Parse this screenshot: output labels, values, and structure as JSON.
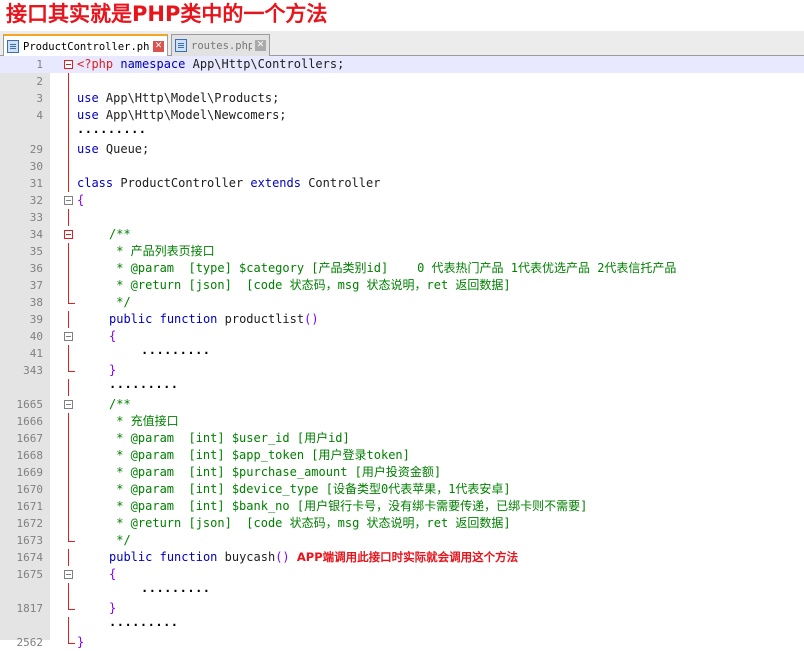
{
  "heading": "接口其实就是PHP类中的一个方法",
  "tabs": [
    {
      "label": "ProductController.php",
      "close": "✕"
    },
    {
      "label": "routes.php",
      "close": "✕"
    }
  ],
  "lines": [
    {
      "num": "1",
      "fold": "box-red",
      "cur": true,
      "indent": 0,
      "segments": [
        {
          "c": "php",
          "t": "<?php"
        },
        {
          "c": "pl",
          "t": " "
        },
        {
          "c": "kw",
          "t": "namespace"
        },
        {
          "c": "pl",
          "t": " App\\Http\\Controllers;"
        }
      ]
    },
    {
      "num": "2",
      "fold": "line",
      "indent": 0,
      "segments": []
    },
    {
      "num": "3",
      "fold": "line",
      "indent": 0,
      "segments": [
        {
          "c": "kw",
          "t": "use"
        },
        {
          "c": "pl",
          "t": " App\\Http\\Model\\Products;"
        }
      ]
    },
    {
      "num": "4",
      "fold": "line",
      "indent": 0,
      "segments": [
        {
          "c": "kw",
          "t": "use"
        },
        {
          "c": "pl",
          "t": " App\\Http\\Model\\Newcomers;"
        }
      ]
    },
    {
      "num": "",
      "fold": "line",
      "indent": 0,
      "segments": [
        {
          "c": "dots",
          "t": "·········"
        }
      ]
    },
    {
      "num": "29",
      "fold": "line",
      "indent": 0,
      "segments": [
        {
          "c": "kw",
          "t": "use"
        },
        {
          "c": "pl",
          "t": " Queue;"
        }
      ]
    },
    {
      "num": "30",
      "fold": "line",
      "indent": 0,
      "segments": []
    },
    {
      "num": "31",
      "fold": "line",
      "indent": 0,
      "segments": [
        {
          "c": "kw",
          "t": "class"
        },
        {
          "c": "pl",
          "t": " ProductController "
        },
        {
          "c": "kw",
          "t": "extends"
        },
        {
          "c": "pl",
          "t": " Controller"
        }
      ]
    },
    {
      "num": "32",
      "fold": "box-grey",
      "indent": 0,
      "segments": [
        {
          "c": "br",
          "t": "{"
        }
      ]
    },
    {
      "num": "33",
      "fold": "line",
      "indent": 1,
      "segments": []
    },
    {
      "num": "34",
      "fold": "box-red",
      "indent": 1,
      "segments": [
        {
          "c": "cm",
          "t": "/**"
        }
      ]
    },
    {
      "num": "35",
      "fold": "line",
      "indent": 1,
      "segments": [
        {
          "c": "cm",
          "t": " * 产品列表页接口"
        }
      ]
    },
    {
      "num": "36",
      "fold": "line",
      "indent": 1,
      "segments": [
        {
          "c": "cm",
          "t": " * @param  [type] $category [产品类别id]    0 代表热门产品 1代表优选产品 2代表信托产品"
        }
      ]
    },
    {
      "num": "37",
      "fold": "line",
      "indent": 1,
      "segments": [
        {
          "c": "cm",
          "t": " * @return [json]  [code 状态码，msg 状态说明，ret 返回数据]"
        }
      ]
    },
    {
      "num": "38",
      "fold": "end",
      "indent": 1,
      "segments": [
        {
          "c": "cm",
          "t": " */"
        }
      ]
    },
    {
      "num": "39",
      "fold": "line",
      "indent": 1,
      "segments": [
        {
          "c": "kw",
          "t": "public"
        },
        {
          "c": "pl",
          "t": " "
        },
        {
          "c": "kw",
          "t": "function"
        },
        {
          "c": "pl",
          "t": " productlist"
        },
        {
          "c": "br",
          "t": "()"
        }
      ]
    },
    {
      "num": "40",
      "fold": "box-grey",
      "indent": 1,
      "segments": [
        {
          "c": "br",
          "t": "{"
        }
      ]
    },
    {
      "num": "41",
      "fold": "line",
      "indent": 2,
      "segments": [
        {
          "c": "dots",
          "t": "·········"
        }
      ]
    },
    {
      "num": "343",
      "fold": "end",
      "indent": 1,
      "segments": [
        {
          "c": "br",
          "t": "}"
        }
      ]
    },
    {
      "num": "",
      "fold": "line",
      "indent": 1,
      "segments": [
        {
          "c": "dots",
          "t": "·········"
        }
      ]
    },
    {
      "num": "1665",
      "fold": "box-grey",
      "indent": 1,
      "segments": [
        {
          "c": "cm",
          "t": "/**"
        }
      ]
    },
    {
      "num": "1666",
      "fold": "line",
      "indent": 1,
      "segments": [
        {
          "c": "cm",
          "t": " * 充值接口"
        }
      ]
    },
    {
      "num": "1667",
      "fold": "line",
      "indent": 1,
      "segments": [
        {
          "c": "cm",
          "t": " * @param  [int] $user_id [用户id]"
        }
      ]
    },
    {
      "num": "1668",
      "fold": "line",
      "indent": 1,
      "segments": [
        {
          "c": "cm",
          "t": " * @param  [int] $app_token [用户登录token]"
        }
      ]
    },
    {
      "num": "1669",
      "fold": "line",
      "indent": 1,
      "segments": [
        {
          "c": "cm",
          "t": " * @param  [int] $purchase_amount [用户投资金额]"
        }
      ]
    },
    {
      "num": "1670",
      "fold": "line",
      "indent": 1,
      "segments": [
        {
          "c": "cm",
          "t": " * @param  [int] $device_type [设备类型0代表苹果，1代表安卓]"
        }
      ]
    },
    {
      "num": "1671",
      "fold": "line",
      "indent": 1,
      "segments": [
        {
          "c": "cm",
          "t": " * @param  [int] $bank_no [用户银行卡号，没有绑卡需要传递，已绑卡则不需要]"
        }
      ]
    },
    {
      "num": "1672",
      "fold": "line",
      "indent": 1,
      "segments": [
        {
          "c": "cm",
          "t": " * @return [json]  [code 状态码，msg 状态说明，ret 返回数据]"
        }
      ]
    },
    {
      "num": "1673",
      "fold": "end",
      "indent": 1,
      "segments": [
        {
          "c": "cm",
          "t": " */"
        }
      ]
    },
    {
      "num": "1674",
      "fold": "line",
      "indent": 1,
      "segments": [
        {
          "c": "kw",
          "t": "public"
        },
        {
          "c": "pl",
          "t": " "
        },
        {
          "c": "kw",
          "t": "function"
        },
        {
          "c": "pl",
          "t": " buycash"
        },
        {
          "c": "br",
          "t": "()"
        },
        {
          "c": "pl",
          "t": " "
        },
        {
          "c": "note",
          "t": "APP端调用此接口时实际就会调用这个方法"
        }
      ]
    },
    {
      "num": "1675",
      "fold": "box-grey",
      "indent": 1,
      "segments": [
        {
          "c": "br",
          "t": "{"
        }
      ]
    },
    {
      "num": "",
      "fold": "line",
      "indent": 2,
      "segments": [
        {
          "c": "dots",
          "t": "·········"
        }
      ]
    },
    {
      "num": "1817",
      "fold": "end",
      "indent": 1,
      "segments": [
        {
          "c": "br",
          "t": "}"
        }
      ]
    },
    {
      "num": "",
      "fold": "line",
      "indent": 1,
      "segments": [
        {
          "c": "dots",
          "t": "·········"
        }
      ]
    },
    {
      "num": "2562",
      "fold": "end",
      "indent": 0,
      "segments": [
        {
          "c": "br",
          "t": "}"
        }
      ]
    }
  ]
}
